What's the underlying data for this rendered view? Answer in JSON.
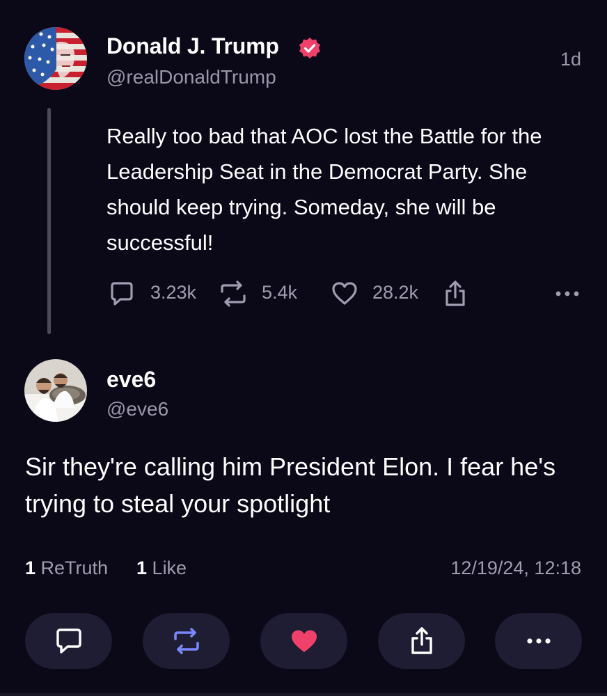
{
  "parent": {
    "display_name": "Donald J. Trump",
    "handle": "@realDonaldTrump",
    "time": "1d",
    "text": "Really too bad that AOC lost the Battle for the Leadership Seat in the Democrat Party. She should keep trying. Someday, she will be successful!",
    "stats": {
      "replies": "3.23k",
      "retruths": "5.4k",
      "likes": "28.2k"
    }
  },
  "reply": {
    "display_name": "eve6",
    "handle": "@eve6",
    "text": "Sir they're calling him President Elon. I fear he's trying to steal your spotlight",
    "retruth_count": "1",
    "retruth_label": "ReTruth",
    "like_count": "1",
    "like_label": "Like",
    "timestamp": "12/19/24, 12:18"
  },
  "colors": {
    "background": "#0b0818",
    "accent": "#f0416a",
    "retruth_accent": "#7a86ff",
    "muted": "#a09db1",
    "button_bg": "#1f1d33"
  }
}
